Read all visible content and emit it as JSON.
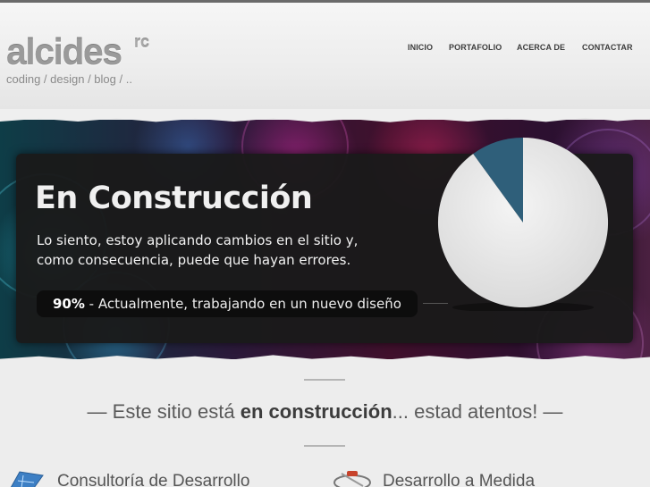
{
  "header": {
    "logo_main": "alcides",
    "logo_sup": "rc",
    "tagline": "coding / design / blog / ..",
    "nav": [
      {
        "label": "INICIO"
      },
      {
        "label": "PORTAFOLIO"
      },
      {
        "label": "ACERCA DE"
      },
      {
        "label": "CONTACTAR"
      }
    ]
  },
  "banner": {
    "title": "En Construcción",
    "text_line1": "Lo siento, estoy aplicando cambios en el sitio y,",
    "text_line2": "como consecuencia, puede que hayan errores.",
    "progress_percent_label": "90%",
    "progress_text": " - Actualmente, trabajando en un nuevo diseño",
    "progress_value": 0.9,
    "pie_colors": {
      "done": "#e6e6e6",
      "remaining": "#2f5f7a"
    }
  },
  "notice": {
    "prefix": "— Este sitio está ",
    "emphasis": "en construcción",
    "suffix": "... estad atentos! —"
  },
  "services": [
    {
      "label": "Consultoría de Desarrollo",
      "icon": "blueprint-icon"
    },
    {
      "label": "Desarrollo a Medida",
      "icon": "tools-icon"
    }
  ]
}
